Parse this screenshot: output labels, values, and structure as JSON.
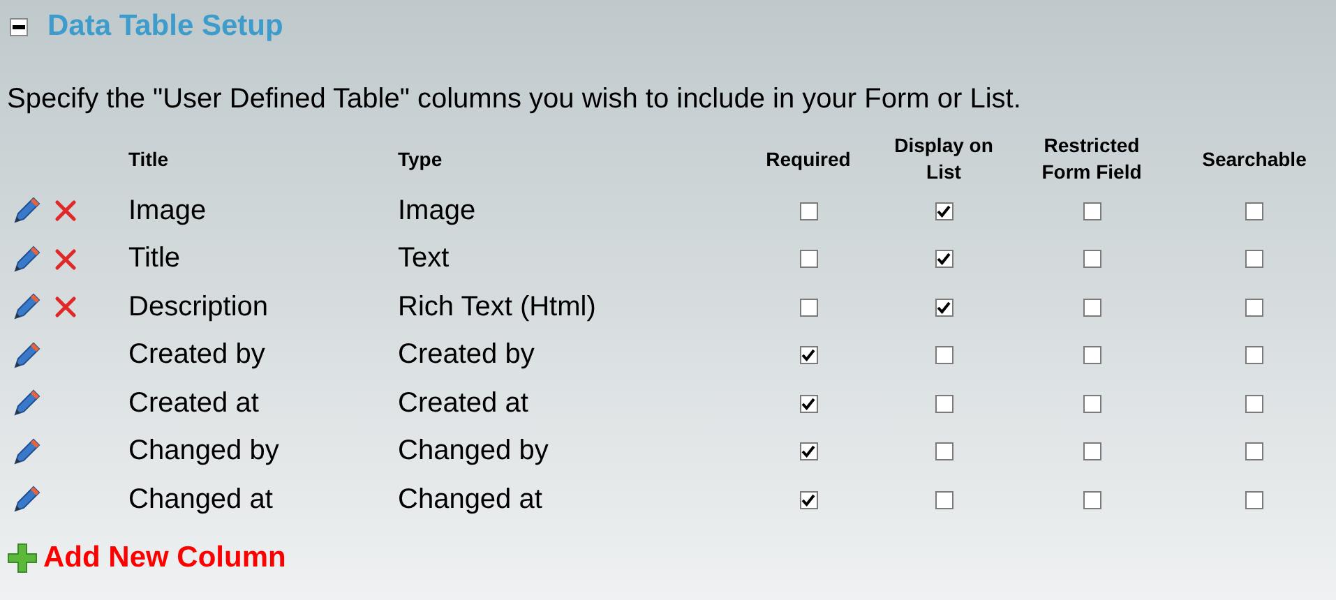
{
  "section": {
    "title": "Data Table Setup",
    "expanded": true
  },
  "intro": "Specify the \"User Defined Table\" columns you wish to include in your Form or List.",
  "columns": [
    "Title",
    "Type",
    "Required",
    "Display on List",
    "Restricted Form Field",
    "Searchable"
  ],
  "rows": [
    {
      "title": "Image",
      "type": "Image",
      "deletable": true,
      "required": false,
      "display_on_list": true,
      "restricted": false,
      "searchable": false
    },
    {
      "title": "Title",
      "type": "Text",
      "deletable": true,
      "required": false,
      "display_on_list": true,
      "restricted": false,
      "searchable": false
    },
    {
      "title": "Description",
      "type": "Rich Text (Html)",
      "deletable": true,
      "required": false,
      "display_on_list": true,
      "restricted": false,
      "searchable": false
    },
    {
      "title": "Created by",
      "type": "Created by",
      "deletable": false,
      "required": true,
      "display_on_list": false,
      "restricted": false,
      "searchable": false
    },
    {
      "title": "Created at",
      "type": "Created at",
      "deletable": false,
      "required": true,
      "display_on_list": false,
      "restricted": false,
      "searchable": false
    },
    {
      "title": "Changed by",
      "type": "Changed by",
      "deletable": false,
      "required": true,
      "display_on_list": false,
      "restricted": false,
      "searchable": false
    },
    {
      "title": "Changed at",
      "type": "Changed at",
      "deletable": false,
      "required": true,
      "display_on_list": false,
      "restricted": false,
      "searchable": false
    }
  ],
  "add_link": "Add New Column"
}
